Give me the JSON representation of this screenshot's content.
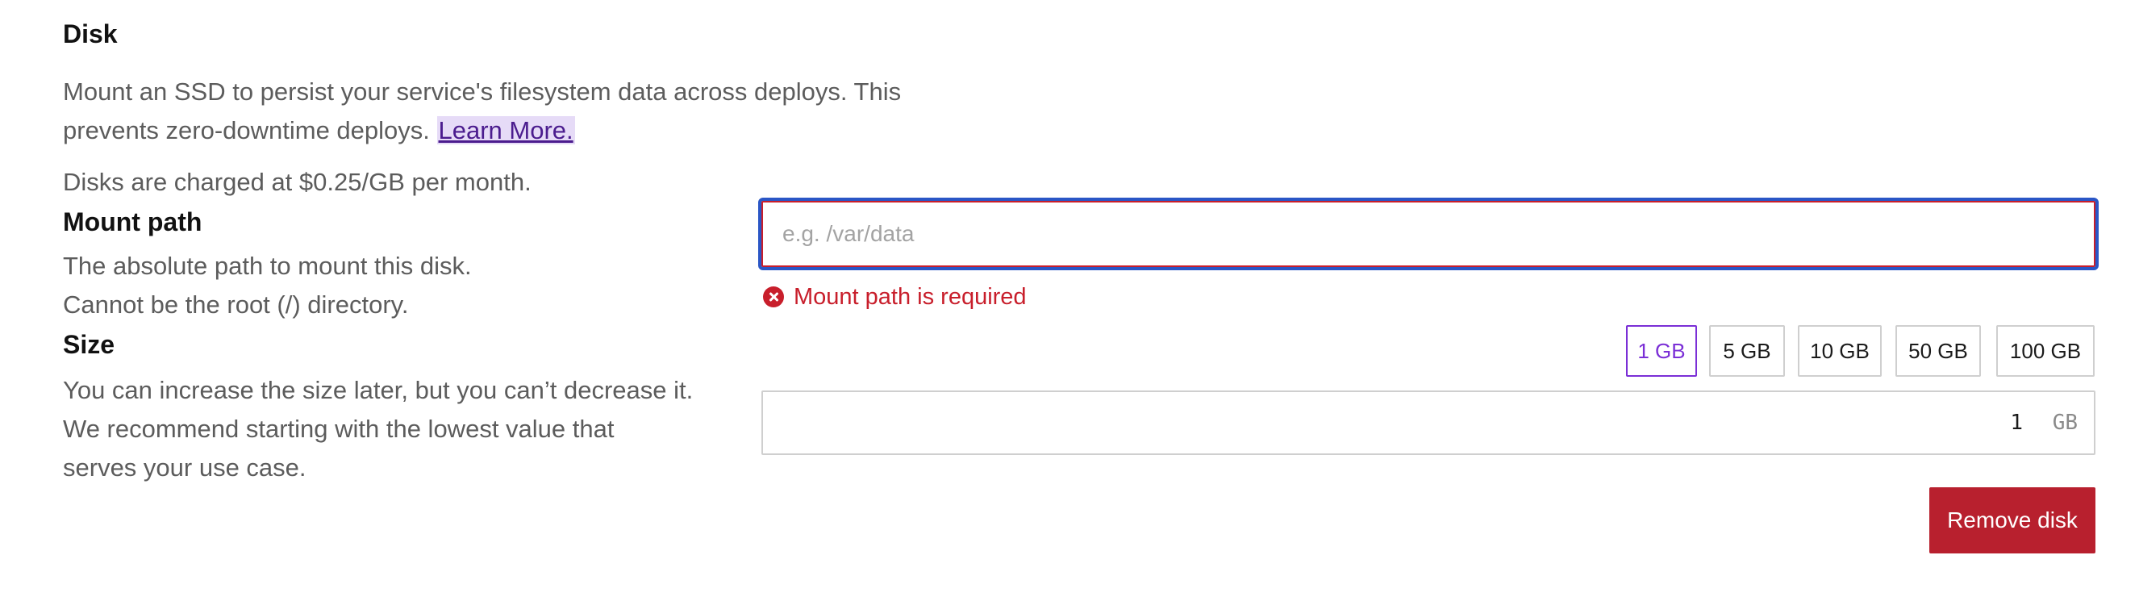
{
  "disk": {
    "title": "Disk",
    "description_line1": "Mount an SSD to persist your service's filesystem data across deploys. This",
    "description_line2": "prevents zero-downtime deploys.",
    "learn_more_label": "Learn More.",
    "pricing": "Disks are charged at $0.25/GB per month."
  },
  "mount_path": {
    "title": "Mount path",
    "description_line1": "The absolute path to mount this disk.",
    "description_line2": "Cannot be the root (/) directory.",
    "placeholder": "e.g. /var/data",
    "value": "",
    "error": "Mount path is required"
  },
  "size": {
    "title": "Size",
    "description_line1": "You can increase the size later, but you can’t decrease it.",
    "description_line2": "We recommend starting with the lowest value that",
    "description_line3": "serves your use case.",
    "options": [
      "1 GB",
      "5 GB",
      "10 GB",
      "50 GB",
      "100 GB"
    ],
    "selected": "1 GB",
    "value": "1",
    "unit": "GB"
  },
  "actions": {
    "remove_label": "Remove disk"
  },
  "colors": {
    "accent_purple": "#7b2fd6",
    "error_red": "#c81e2b",
    "danger_button": "#b8202e",
    "focus_blue": "#2a56c6"
  },
  "icons": {
    "error": "x-circle-icon"
  }
}
